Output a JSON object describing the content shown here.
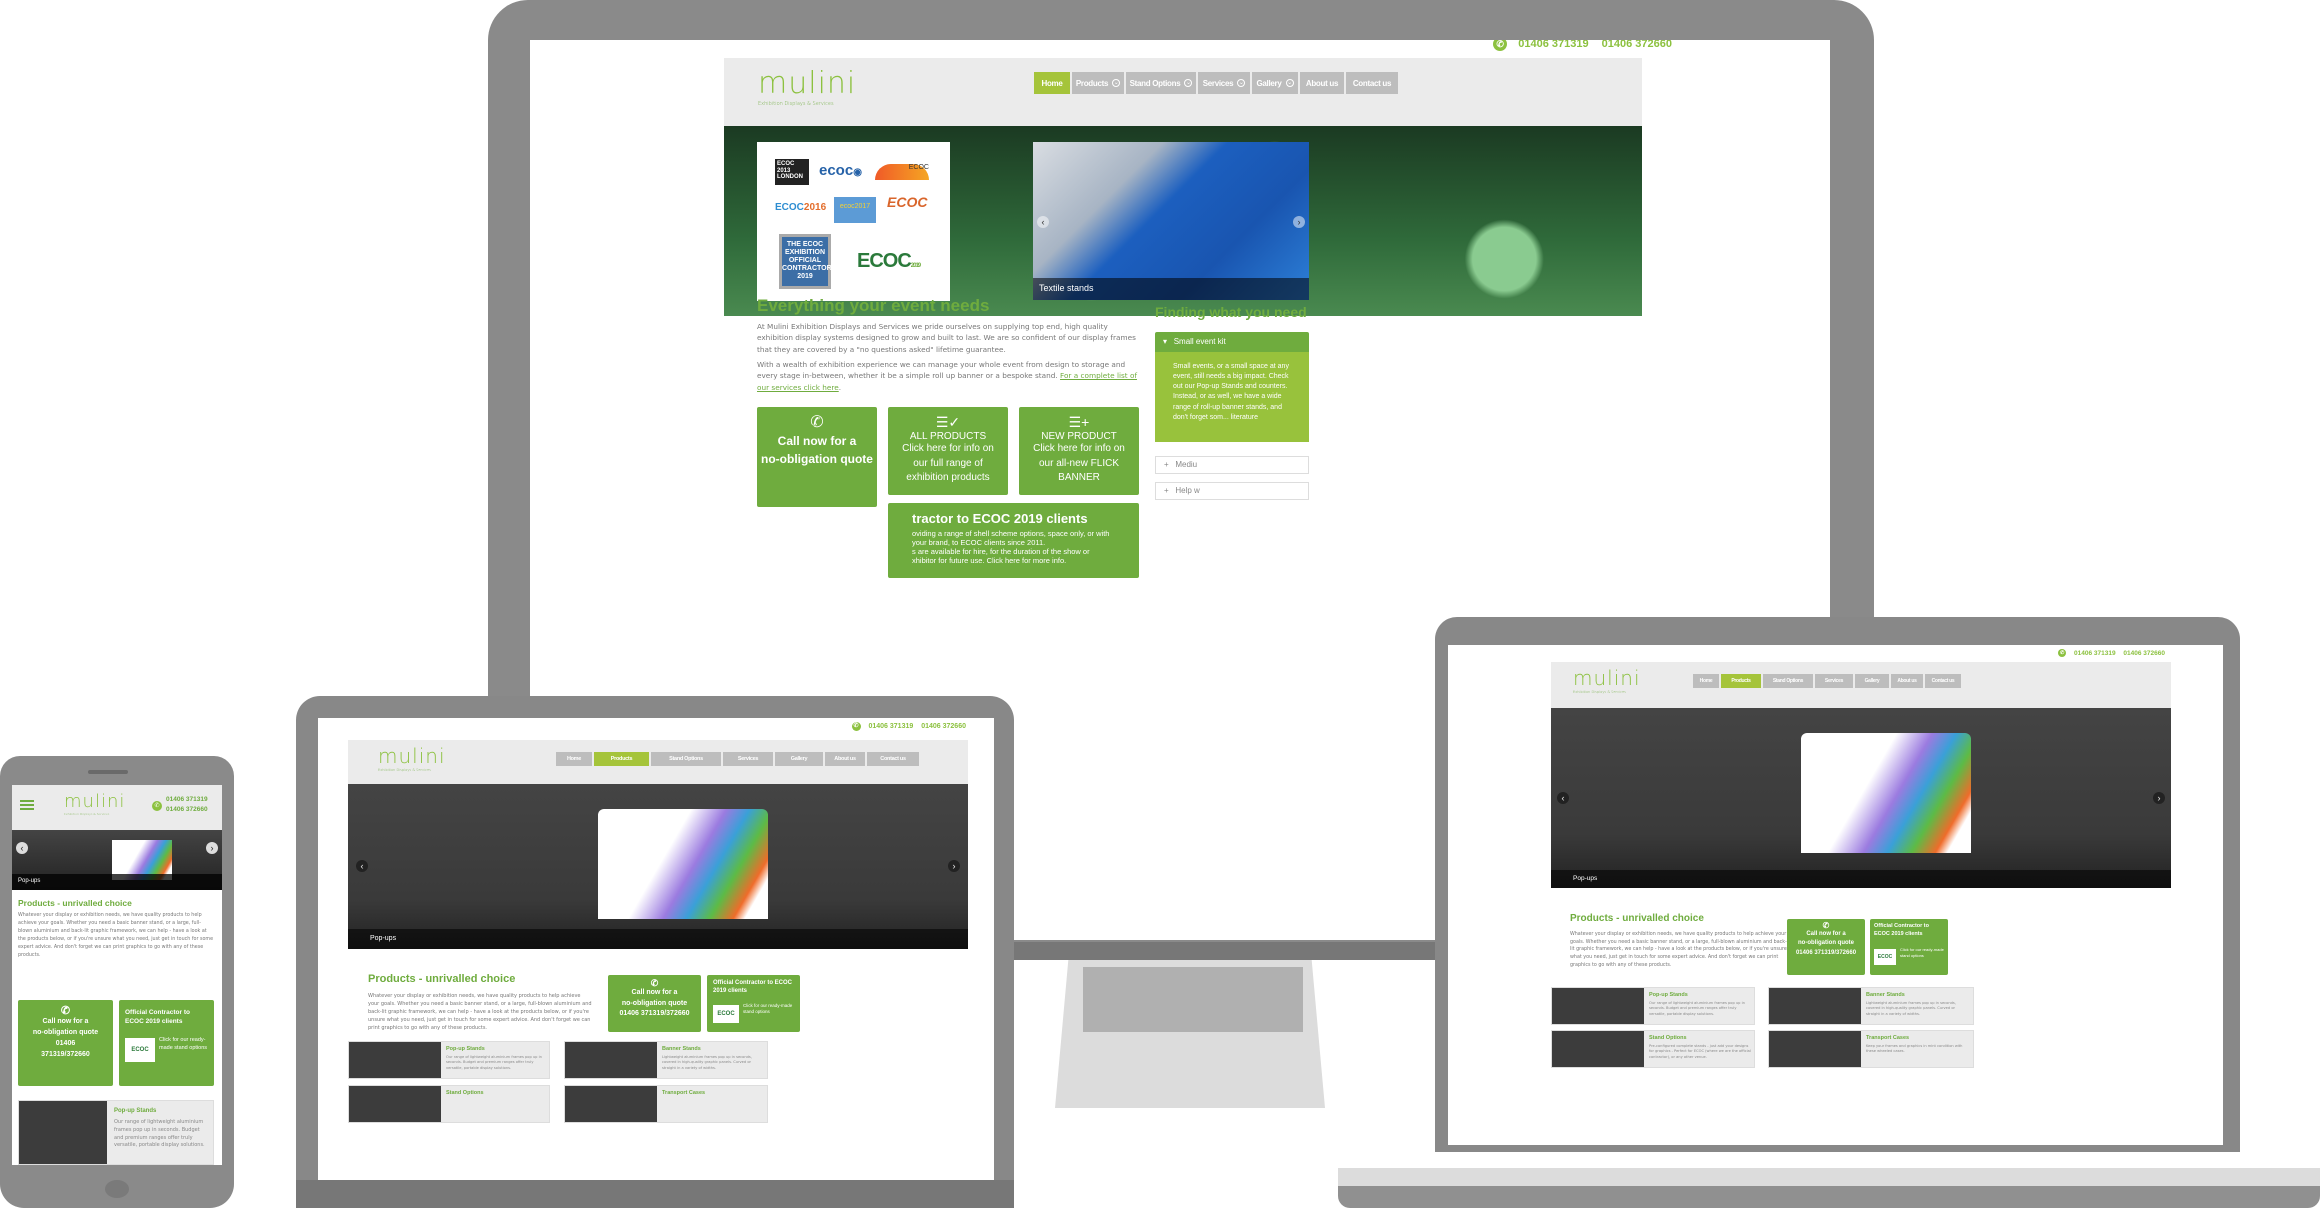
{
  "site": {
    "logo_text": "mulini",
    "logo_tagline": "Exhibition Displays & Services",
    "phone_1": "01406 371319",
    "phone_2": "01406 372660",
    "nav": [
      {
        "label": "Home",
        "dropdown": false
      },
      {
        "label": "Products",
        "dropdown": true
      },
      {
        "label": "Stand Options",
        "dropdown": true
      },
      {
        "label": "Services",
        "dropdown": true
      },
      {
        "label": "Gallery",
        "dropdown": true
      },
      {
        "label": "About us",
        "dropdown": false
      },
      {
        "label": "Contact us",
        "dropdown": false
      }
    ],
    "colors": {
      "brand_green": "#6fac3e",
      "active_nav": "#a5c43a",
      "nav_grey": "#bdbdbd",
      "frame_grey": "#8a8a8a"
    }
  },
  "desktop": {
    "active_nav": "Home",
    "hero_logos": [
      "ECOC 2013 LONDON",
      "ECOC Cannes 2014",
      "ECOC 2015 VALENCIA",
      "ECOC2016 DÜSSELDORF",
      "ECOC2017 GOTHENBURG",
      "ECOC ROMA 2018",
      "THE ECOC EXHIBITION OFFICIAL CONTRACTOR 2019",
      "ECOC DUBLIN 2019"
    ],
    "hero_slide_caption": "Textile stands",
    "heading": "Everything your event needs",
    "para_1": "At Mulini Exhibition Displays and Services we pride ourselves on supplying top end, high quality exhibition display systems designed to grow and built to last. We are so confident of our display frames that they are covered by a \"no questions asked\" lifetime guarantee.",
    "para_2": "With a wealth of exhibition experience we can manage your whole event from design to storage and every stage in-between, whether it be a simple roll up banner or a bespoke stand. ",
    "para_2_link": "For a complete list of our services click here",
    "cards": [
      {
        "icon": "phone-incoming-icon",
        "line1": "Call now for a",
        "line2": "no-obligation quote"
      },
      {
        "icon": "list-check-icon",
        "line1": "ALL PRODUCTS",
        "line2": "Click here for info on our full range of exhibition products"
      },
      {
        "icon": "list-plus-icon",
        "line1": "NEW PRODUCT",
        "line2": "Click here for info on our all-new FLICK BANNER"
      }
    ],
    "ecoc_banner_title": "tractor to ECOC 2019 clients",
    "ecoc_banner_line1": "oviding a range of shell scheme options, space only, or with",
    "ecoc_banner_line2": "your brand, to ECOC clients since 2011.",
    "ecoc_banner_line3": "s are available for hire, for the duration of the show or",
    "ecoc_banner_line4": "xhibitor for future use. Click here for more info.",
    "sidebar_heading": "Finding what you need",
    "accordion": [
      {
        "label": "Small event kit",
        "expanded": true,
        "body": "Small events, or a small space at any event, still needs a big impact. Check out our Pop-up Stands and counters. Instead, or as well, we have a wide range of roll-up banner stands, and don't forget som... literature"
      },
      {
        "label": "Mediu",
        "expanded": false
      },
      {
        "label": "Help w",
        "expanded": false
      }
    ]
  },
  "products_page": {
    "active_nav": "Products",
    "slide_caption": "Pop-ups",
    "heading": "Products - unrivalled choice",
    "para": "Whatever your display or exhibition needs, we have quality products to help achieve your goals. Whether you need a basic banner stand, or a large, full-blown aluminium and back-lit graphic framework, we can help - have a look at the products below, or if you're unsure what you need, just get in touch for some expert advice. And don't forget we can print graphics to go with any of these products.",
    "call_card": {
      "line1": "Call now for a",
      "line2": "no-obligation quote",
      "line3": "01406 371319/372660",
      "line3_mobile_a": "01406",
      "line3_mobile_b": "371319/372660"
    },
    "ecoc_card": {
      "title": "Official Contractor to ECOC 2019 clients",
      "body": "Click for our ready-made stand options",
      "thumb": "ECOC"
    },
    "tiles": [
      {
        "title": "Pop-up Stands",
        "body": "Our range of lightweight aluminium frames pop up in seconds. Budget and premium ranges offer truly versatile, portable display solutions."
      },
      {
        "title": "Banner Stands",
        "body": "Lightweight aluminium frames pop up in seconds, covered in high-quality graphic panels. Curved or straight in a variety of widths."
      },
      {
        "title": "Stand Options",
        "body": "Pre-configured complete stands - just add your designs for graphics - Perfect for ECOC (where we are the official contractor), or any other venue."
      },
      {
        "title": "Transport Cases",
        "body": "Keep your frames and graphics in mint condition with these wheeled cases."
      }
    ]
  }
}
